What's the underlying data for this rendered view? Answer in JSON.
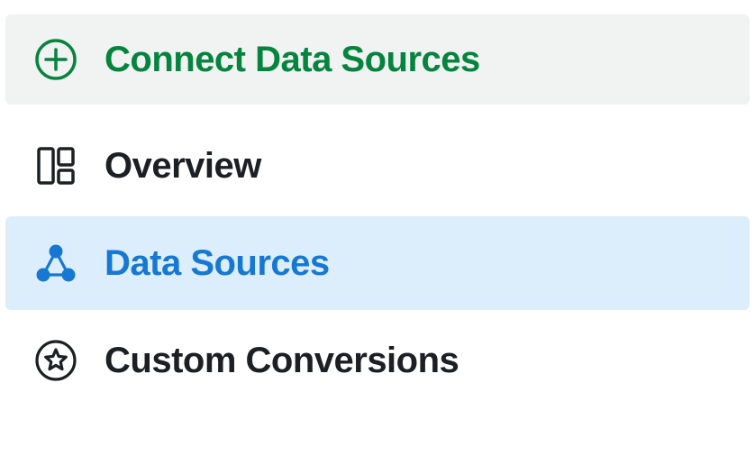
{
  "sidebar": {
    "connect_label": "Connect Data Sources",
    "items": [
      {
        "label": "Overview"
      },
      {
        "label": "Data Sources"
      },
      {
        "label": "Custom Conversions"
      }
    ]
  }
}
